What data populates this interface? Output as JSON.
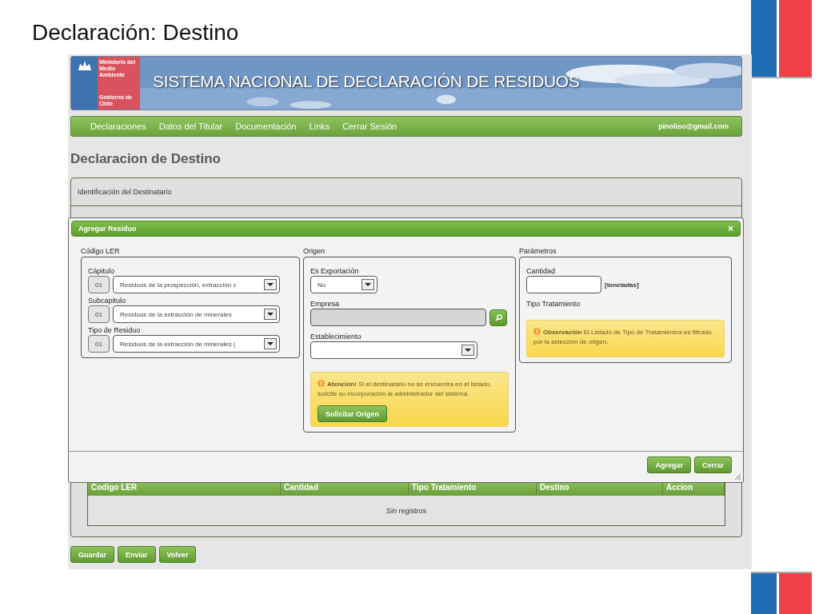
{
  "slide": {
    "title": "Declaración: Destino"
  },
  "banner": {
    "ministry": "Ministerio del Medio Ambiente",
    "government": "Gobierno de Chile",
    "title": "SISTEMA NACIONAL DE DECLARACIÓN DE RESIDUOS"
  },
  "nav": {
    "items": [
      "Declaraciones",
      "Datos del Titular",
      "Documentación",
      "Links",
      "Cerrar Sesión"
    ],
    "user": "pinoliso@gmail.com"
  },
  "page": {
    "heading": "Declaracion de Destino",
    "section": "Identificación del Destinatario"
  },
  "table": {
    "columns": [
      "Codigo LER",
      "Cantidad",
      "Tipo Tratamiento",
      "Destino",
      "Accion"
    ],
    "empty": "Sin registros"
  },
  "page_buttons": [
    "Guardar",
    "Enviar",
    "Volver"
  ],
  "dialog": {
    "title": "Agregar Residuo",
    "close": "×",
    "codigo_ler": {
      "legend": "Código LER",
      "fields": [
        {
          "label": "Cápitulo",
          "code": "01",
          "value": "Residuos de la prospección, extracción c"
        },
        {
          "label": "Subcapitulo",
          "code": "01",
          "value": "Residuos de la extracción de minerales"
        },
        {
          "label": "Tipo de Residuo",
          "code": "01",
          "value": "Residuos de la extracción de minerales ("
        }
      ]
    },
    "origen": {
      "legend": "Origen",
      "export_label": "Es Exportación",
      "export_value": "No",
      "empresa_label": "Empresa",
      "empresa_disabled": true,
      "establecimiento_label": "Establecimiento",
      "alert": "**Atención!** Si el destinatario no se encuentra en el listado, solicite su incorporación al administrador del sistema.",
      "alert_button": "Solicitar Origen"
    },
    "parametros": {
      "legend": "Parámetros",
      "cantidad_label": "Cantidad",
      "unit": "[toneladas]",
      "tipo_label": "Tipo Tratamiento",
      "note": "**Observación** El Listado de Tipo de Tratamientos es filtrado por la selección de origen."
    },
    "buttons": [
      "Agregar",
      "Cerrar"
    ]
  }
}
